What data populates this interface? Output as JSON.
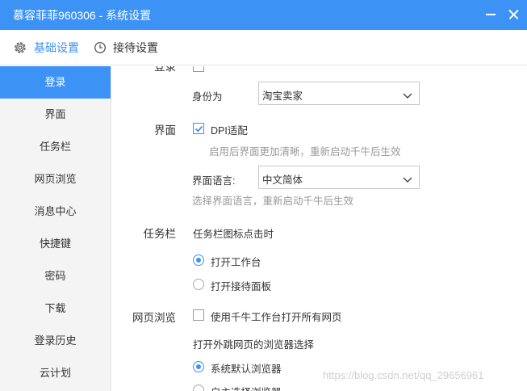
{
  "window": {
    "title": "慕容菲菲960306 - 系统设置"
  },
  "tabs": [
    {
      "label": "基础设置",
      "icon": "gear-icon",
      "active": true
    },
    {
      "label": "接待设置",
      "icon": "clock-icon",
      "active": false
    }
  ],
  "sidebar": {
    "items": [
      {
        "label": "登录",
        "active": true
      },
      {
        "label": "界面"
      },
      {
        "label": "任务栏"
      },
      {
        "label": "网页浏览"
      },
      {
        "label": "消息中心"
      },
      {
        "label": "快捷键"
      },
      {
        "label": "密码"
      },
      {
        "label": "下载"
      },
      {
        "label": "登录历史"
      },
      {
        "label": "云计划"
      }
    ]
  },
  "login": {
    "section_label": "登录",
    "identity_label": "身份为",
    "identity_value": "淘宝卖家"
  },
  "interface": {
    "section_label": "界面",
    "dpi_label": "DPI适配",
    "dpi_checked": true,
    "dpi_hint": "启用后界面更加清晰，重新启动千牛后生效",
    "language_label": "界面语言:",
    "language_value": "中文简体",
    "language_hint": "选择界面语言，重新启动千牛后生效"
  },
  "taskbar": {
    "section_label": "任务栏",
    "click_label": "任务栏图标点击时",
    "options": [
      {
        "label": "打开工作台",
        "checked": true
      },
      {
        "label": "打开接待面板",
        "checked": false
      }
    ]
  },
  "browsing": {
    "section_label": "网页浏览",
    "use_workbench_label": "使用千牛工作台打开所有网页",
    "use_workbench_checked": false,
    "browser_choice_label": "打开外跳网页的浏览器选择",
    "options": [
      {
        "label": "系统默认浏览器",
        "checked": true
      },
      {
        "label": "自主选择浏览器",
        "checked": false
      }
    ]
  },
  "watermark": "https://blog.csdn.net/qq_29656961",
  "colors": {
    "accent": "#3d93f5",
    "sidebar_bg": "#f4f4f4",
    "hint": "#999999"
  }
}
